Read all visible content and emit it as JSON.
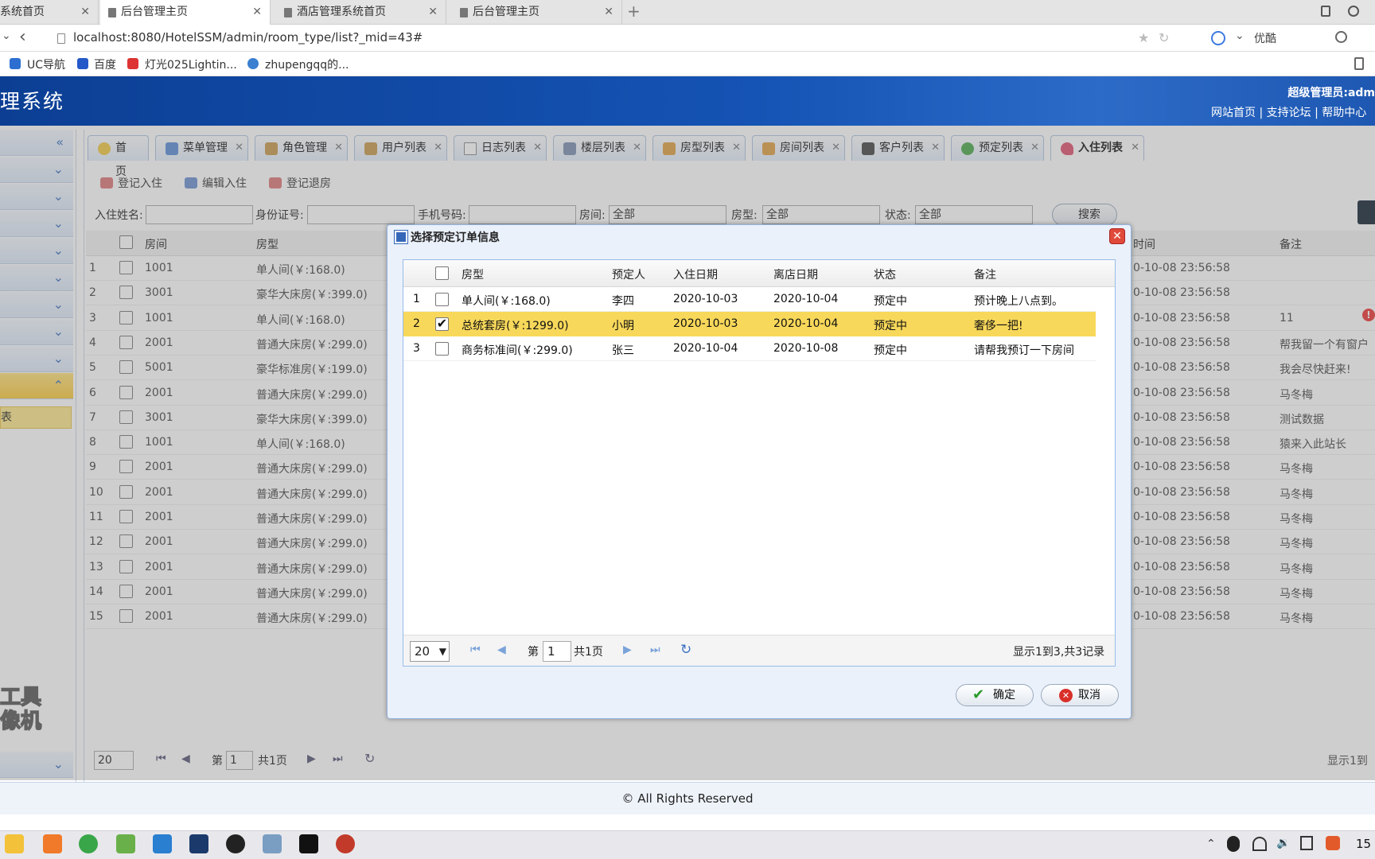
{
  "browser": {
    "tabs": [
      {
        "label": "系统首页",
        "active": false
      },
      {
        "label": "后台管理主页",
        "active": true
      },
      {
        "label": "酒店管理系统首页",
        "active": false
      },
      {
        "label": "后台管理主页",
        "active": false
      }
    ],
    "url": "localhost:8080/HotelSSM/admin/room_type/list?_mid=43#",
    "search_engine": "优酷",
    "bookmarks": [
      "UC导航",
      "百度",
      "灯光025Lightin...",
      "zhupengqq的..."
    ]
  },
  "header": {
    "title": "理系统",
    "user": "超级管理员:adm",
    "links": [
      "网站首页",
      "|",
      "支持论坛",
      "|",
      "帮助中心"
    ]
  },
  "sidebar": {
    "active_label": "表"
  },
  "page_tabs": [
    "首页",
    "菜单管理",
    "角色管理",
    "用户列表",
    "日志列表",
    "楼层列表",
    "房型列表",
    "房间列表",
    "客户列表",
    "预定列表",
    "入住列表"
  ],
  "toolbar": [
    "登记入住",
    "编辑入住",
    "登记退房"
  ],
  "search": {
    "name_label": "入住姓名:",
    "id_label": "身份证号:",
    "phone_label": "手机号码:",
    "room_label": "房间:",
    "room_value": "全部",
    "type_label": "房型:",
    "type_value": "全部",
    "status_label": "状态:",
    "status_value": "全部",
    "search_btn": "搜索"
  },
  "bg_table": {
    "headers": [
      "房间",
      "房型",
      "时间",
      "备注"
    ],
    "rows": [
      [
        "1",
        "1001",
        "单人间(￥:168.0)",
        "0-10-08 23:56:58",
        ""
      ],
      [
        "2",
        "3001",
        "豪华大床房(￥:399.0)",
        "0-10-08 23:56:58",
        ""
      ],
      [
        "3",
        "1001",
        "单人间(￥:168.0)",
        "0-10-08 23:56:58",
        "11"
      ],
      [
        "4",
        "2001",
        "普通大床房(￥:299.0)",
        "0-10-08 23:56:58",
        "帮我留一个有窗户"
      ],
      [
        "5",
        "5001",
        "豪华标准房(￥:199.0)",
        "0-10-08 23:56:58",
        "我会尽快赶来!"
      ],
      [
        "6",
        "2001",
        "普通大床房(￥:299.0)",
        "0-10-08 23:56:58",
        "马冬梅"
      ],
      [
        "7",
        "3001",
        "豪华大床房(￥:399.0)",
        "0-10-08 23:56:58",
        "测试数据"
      ],
      [
        "8",
        "1001",
        "单人间(￥:168.0)",
        "0-10-08 23:56:58",
        "猿来入此站长"
      ],
      [
        "9",
        "2001",
        "普通大床房(￥:299.0)",
        "0-10-08 23:56:58",
        "马冬梅"
      ],
      [
        "10",
        "2001",
        "普通大床房(￥:299.0)",
        "0-10-08 23:56:58",
        "马冬梅"
      ],
      [
        "11",
        "2001",
        "普通大床房(￥:299.0)",
        "0-10-08 23:56:58",
        "马冬梅"
      ],
      [
        "12",
        "2001",
        "普通大床房(￥:299.0)",
        "0-10-08 23:56:58",
        "马冬梅"
      ],
      [
        "13",
        "2001",
        "普通大床房(￥:299.0)",
        "0-10-08 23:56:58",
        "马冬梅"
      ],
      [
        "14",
        "2001",
        "普通大床房(￥:299.0)",
        "0-10-08 23:56:58",
        "马冬梅"
      ],
      [
        "15",
        "2001",
        "普通大床房(￥:299.0)",
        "0-10-08 23:56:58",
        "马冬梅"
      ]
    ],
    "pager": {
      "size": "20",
      "page_prefix": "第",
      "page": "1",
      "total": "共1页",
      "info": "显示1到"
    }
  },
  "dialog": {
    "title": "选择预定订单信息",
    "headers": [
      "房型",
      "预定人",
      "入住日期",
      "离店日期",
      "状态",
      "备注"
    ],
    "rows": [
      {
        "num": "1",
        "type": "单人间(￥:168.0)",
        "person": "李四",
        "in": "2020-10-03",
        "out": "2020-10-04",
        "status": "预定中",
        "note": "预计晚上八点到。",
        "checked": false
      },
      {
        "num": "2",
        "type": "总统套房(￥:1299.0)",
        "person": "小明",
        "in": "2020-10-03",
        "out": "2020-10-04",
        "status": "预定中",
        "note": "奢侈一把!",
        "checked": true
      },
      {
        "num": "3",
        "type": "商务标准间(￥:299.0)",
        "person": "张三",
        "in": "2020-10-04",
        "out": "2020-10-08",
        "status": "预定中",
        "note": "请帮我预订一下房间",
        "checked": false
      }
    ],
    "pager": {
      "size": "20",
      "page_prefix": "第",
      "page": "1",
      "total": "共1页",
      "info": "显示1到3,共3记录"
    },
    "ok": "确定",
    "cancel": "取消"
  },
  "watermark": [
    "工具",
    "像机"
  ],
  "footer": "© All Rights Reserved",
  "taskbar": {
    "clock": "15"
  }
}
